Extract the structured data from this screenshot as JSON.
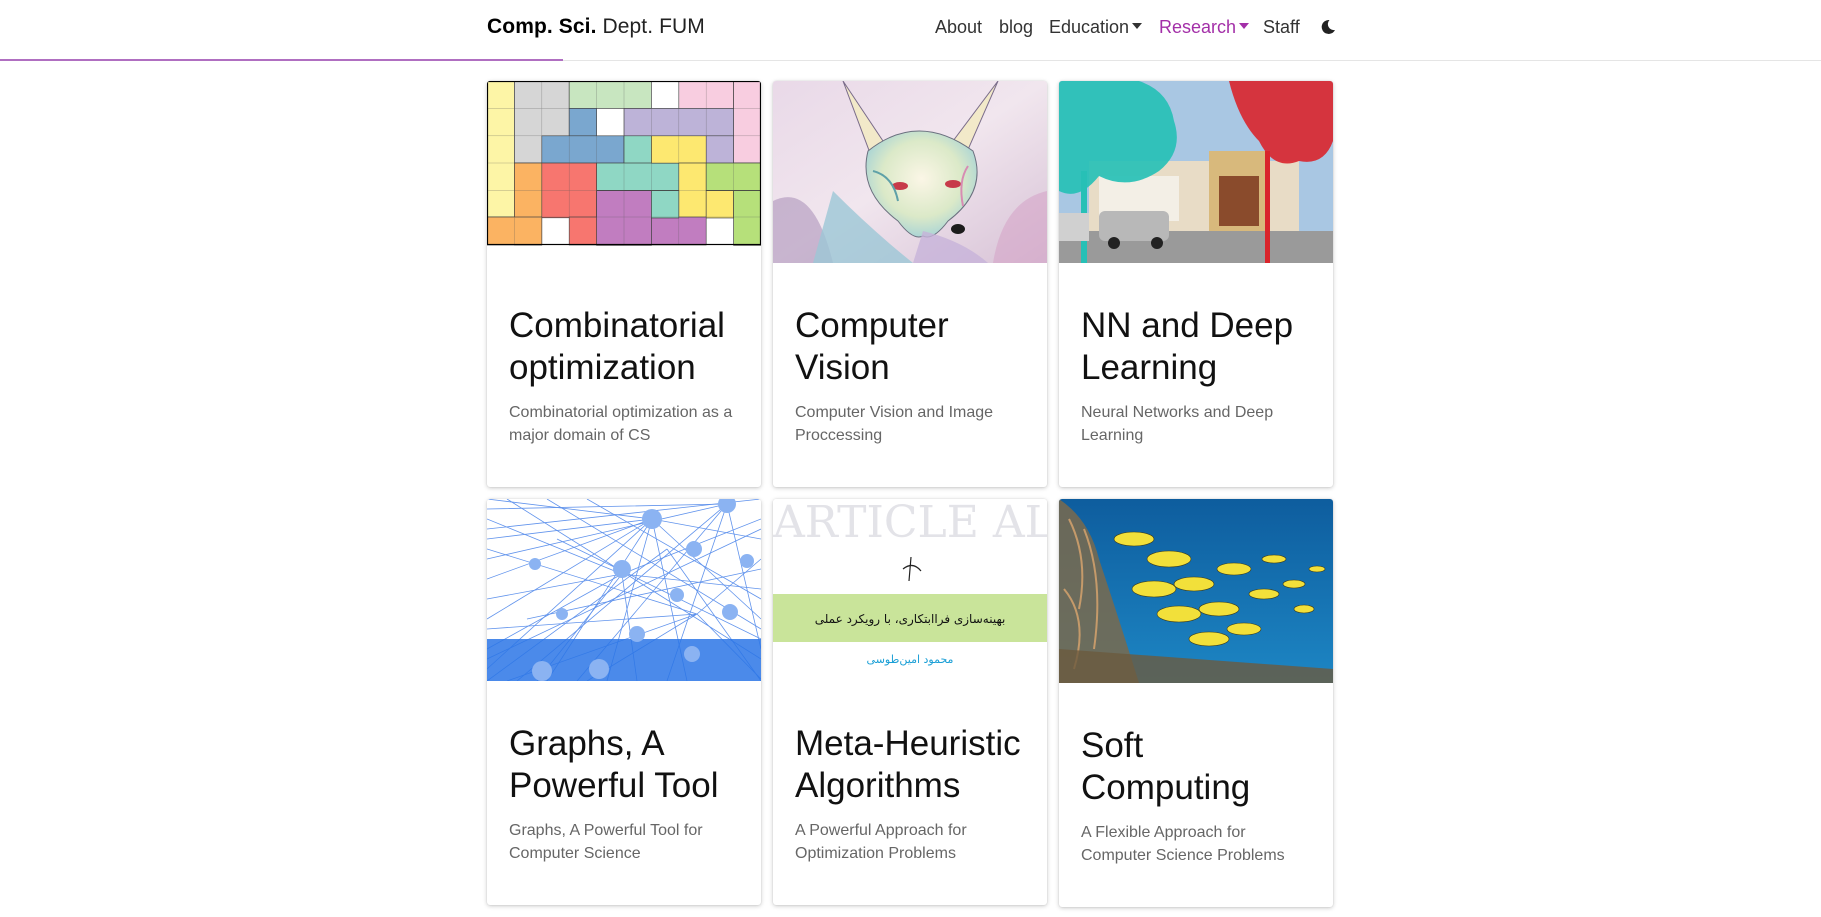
{
  "navbar": {
    "brand_bold": "Comp. Sci.",
    "brand_light": " Dept. FUM",
    "progress_fraction": 0.309,
    "items": [
      {
        "label": "About"
      },
      {
        "label": "blog"
      },
      {
        "label": "Education"
      },
      {
        "label": "Research"
      },
      {
        "label": "Staff"
      }
    ],
    "active_color": "#a32fa8",
    "theme_toggle_icon": "moon-icon"
  },
  "cards": [
    {
      "title": "Combinatorial optimization",
      "description": "Combinatorial optimization as a major domain of CS"
    },
    {
      "title": "Computer Vision",
      "description": "Computer Vision and Image Proccessing"
    },
    {
      "title": "NN and Deep Learning",
      "description": "Neural Networks and Deep Learning"
    },
    {
      "title": "Graphs, A Powerful Tool",
      "description": "Graphs, A Powerful Tool for Computer Science"
    },
    {
      "title": "Meta-Heuristic Algorithms",
      "description": "A Powerful Approach for Optimization Problems"
    },
    {
      "title": "Soft Computing",
      "description": "A Flexible Approach for Computer Science Problems"
    }
  ],
  "meta_heuristic_image": {
    "persian_title": "بهینه‌سازی فراابتکاری، با رویکرد عملی",
    "persian_author": "محمود امین‌طوسی",
    "bg_words": "ARTICLE ALGORITHMS AGENTS SWARM"
  }
}
